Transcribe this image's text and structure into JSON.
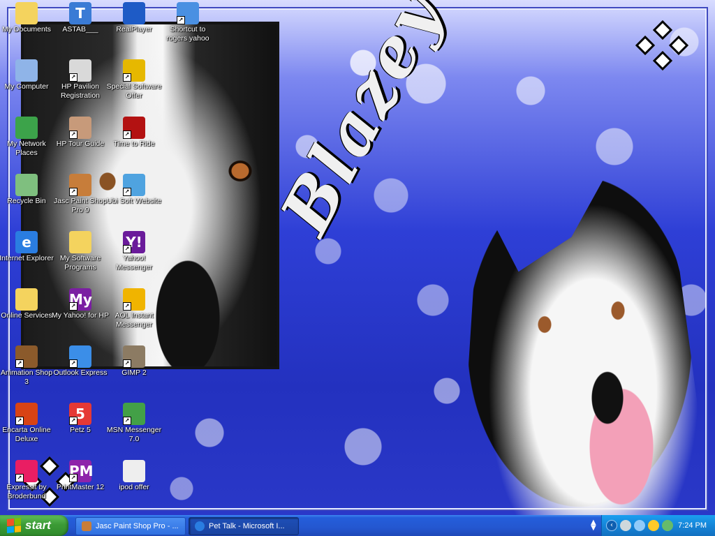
{
  "desktop": {
    "wallpaper_text": "Blazey",
    "icons": [
      {
        "label": "My Documents",
        "icon": "folder-docs-icon",
        "color": "#f4d35e",
        "shortcut": false,
        "glyph": ""
      },
      {
        "label": "ASTAB___",
        "icon": "text-file-icon",
        "color": "#3a7bd5",
        "shortcut": false,
        "glyph": "T"
      },
      {
        "label": "RealPlayer",
        "icon": "realplayer-icon",
        "color": "#1e5bc6",
        "shortcut": false,
        "glyph": ""
      },
      {
        "label": "Shortcut to rogers yahoo",
        "icon": "network-shortcut-icon",
        "color": "#4a90e2",
        "shortcut": true,
        "glyph": ""
      },
      {
        "label": "My Computer",
        "icon": "computer-icon",
        "color": "#8fb4e8",
        "shortcut": false,
        "glyph": ""
      },
      {
        "label": "HP Pavilion Registration",
        "icon": "registration-icon",
        "color": "#d9d9d9",
        "shortcut": true,
        "glyph": ""
      },
      {
        "label": "Special Software Offer",
        "icon": "cd-offer-icon",
        "color": "#e6b800",
        "shortcut": true,
        "glyph": ""
      },
      {
        "label": "My Network Places",
        "icon": "network-places-icon",
        "color": "#3ca34a",
        "shortcut": false,
        "glyph": ""
      },
      {
        "label": "HP Tour Guide",
        "icon": "tour-guide-icon",
        "color": "#c79a7a",
        "shortcut": true,
        "glyph": ""
      },
      {
        "label": "Time to Ride",
        "icon": "game-icon",
        "color": "#b31212",
        "shortcut": true,
        "glyph": ""
      },
      {
        "label": "Recycle Bin",
        "icon": "recycle-bin-icon",
        "color": "#7fbf7f",
        "shortcut": false,
        "glyph": ""
      },
      {
        "label": "Jasc Paint Shop Pro 9",
        "icon": "paint-icon",
        "color": "#c77d3a",
        "shortcut": true,
        "glyph": ""
      },
      {
        "label": "Ubi Soft Website",
        "icon": "web-icon",
        "color": "#4fa3e0",
        "shortcut": true,
        "glyph": ""
      },
      {
        "label": "Internet Explorer",
        "icon": "internet-explorer-icon",
        "color": "#2a7de1",
        "shortcut": false,
        "glyph": "e"
      },
      {
        "label": "My Software Programs",
        "icon": "software-folder-icon",
        "color": "#f4d35e",
        "shortcut": false,
        "glyph": ""
      },
      {
        "label": "Yahoo! Messenger",
        "icon": "yahoo-messenger-icon",
        "color": "#6a1b9a",
        "shortcut": true,
        "glyph": "Y!"
      },
      {
        "label": "Online Services",
        "icon": "folder-icon",
        "color": "#f4d35e",
        "shortcut": false,
        "glyph": ""
      },
      {
        "label": "My Yahoo! for HP",
        "icon": "my-yahoo-icon",
        "color": "#7b1fa2",
        "shortcut": true,
        "glyph": "My"
      },
      {
        "label": "AOL Instant Messenger",
        "icon": "aim-icon",
        "color": "#f0b400",
        "shortcut": true,
        "glyph": ""
      },
      {
        "label": "Animation Shop 3",
        "icon": "film-icon",
        "color": "#8b5a2b",
        "shortcut": true,
        "glyph": ""
      },
      {
        "label": "Outlook Express",
        "icon": "outlook-express-icon",
        "color": "#3b8ee8",
        "shortcut": true,
        "glyph": ""
      },
      {
        "label": "GIMP 2",
        "icon": "gimp-icon",
        "color": "#8c7b63",
        "shortcut": true,
        "glyph": ""
      },
      {
        "label": "Encarta Online Deluxe",
        "icon": "encarta-icon",
        "color": "#d84315",
        "shortcut": true,
        "glyph": ""
      },
      {
        "label": "Petz 5",
        "icon": "petz-icon",
        "color": "#e53935",
        "shortcut": true,
        "glyph": "5"
      },
      {
        "label": "MSN Messenger 7.0",
        "icon": "msn-icon",
        "color": "#43a047",
        "shortcut": true,
        "glyph": ""
      },
      {
        "label": "Expressit by Broderbund",
        "icon": "expressit-icon",
        "color": "#e91e63",
        "shortcut": true,
        "glyph": ""
      },
      {
        "label": "PrintMaster 12",
        "icon": "printmaster-icon",
        "color": "#8e24aa",
        "shortcut": true,
        "glyph": "PM"
      },
      {
        "label": "ipod offer",
        "icon": "document-icon",
        "color": "#eeeeee",
        "shortcut": false,
        "glyph": ""
      }
    ]
  },
  "taskbar": {
    "start_label": "start",
    "tasks": [
      {
        "label": "Jasc Paint Shop Pro - ...",
        "icon": "paint-icon",
        "active": false
      },
      {
        "label": "Pet Talk - Microsoft I...",
        "icon": "internet-explorer-icon",
        "active": true
      }
    ],
    "tray": {
      "clock": "7:24 PM",
      "icons": [
        "volume-icon",
        "network-icon",
        "aim-tray-icon",
        "messenger-tray-icon"
      ]
    }
  },
  "colors": {
    "taskbar_blue": "#245edb",
    "start_green": "#3c9b36",
    "tray_blue": "#1585d8"
  }
}
